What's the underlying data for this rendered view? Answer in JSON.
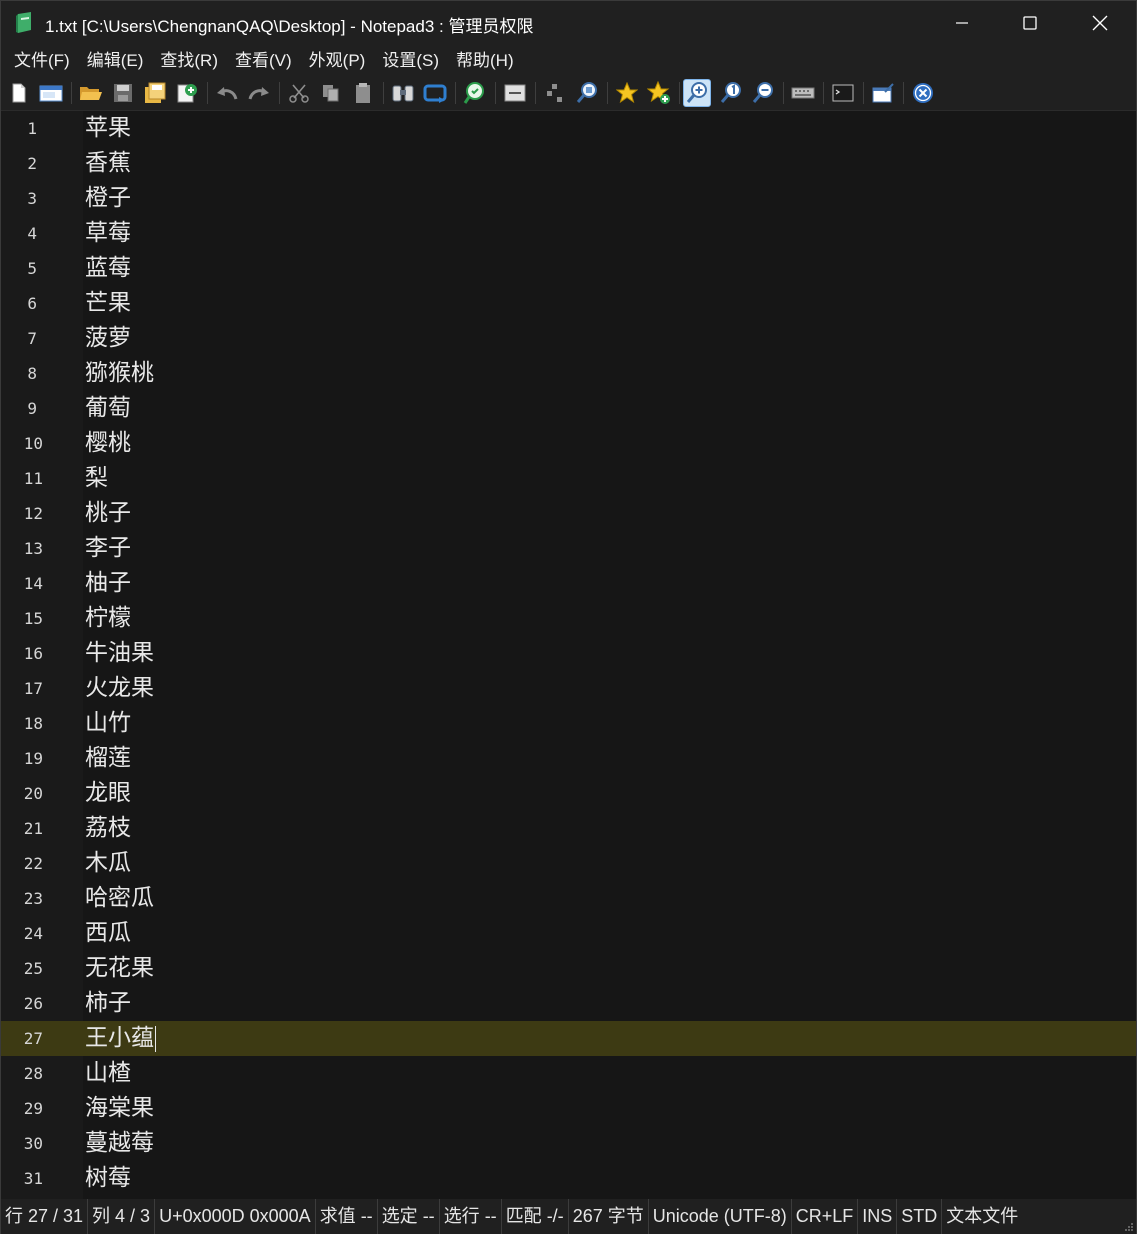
{
  "window": {
    "title": "1.txt [C:\\Users\\ChengnanQAQ\\Desktop] - Notepad3 : 管理员权限"
  },
  "menu": [
    {
      "label": "文件(F)"
    },
    {
      "label": "编辑(E)"
    },
    {
      "label": "查找(R)"
    },
    {
      "label": "查看(V)"
    },
    {
      "label": "外观(P)"
    },
    {
      "label": "设置(S)"
    },
    {
      "label": "帮助(H)"
    }
  ],
  "toolbar": [
    "new-file-icon",
    "new-window-icon",
    "open-folder-icon",
    "save-icon",
    "save-as-icon",
    "save-copy-icon",
    "undo-icon",
    "redo-icon",
    "cut-icon",
    "copy-icon",
    "paste-icon",
    "find-icon",
    "replace-icon",
    "find-in-files-icon",
    "goto-line-icon",
    "column-icon",
    "zoom-in-page-icon",
    "favorite-icon",
    "add-favorite-icon",
    "zoom-in-icon",
    "reset-zoom-icon",
    "zoom-out-icon",
    "scheme-icon",
    "terminal-icon",
    "pin-icon",
    "exit-icon"
  ],
  "editor": {
    "current_line": 27,
    "lines": [
      {
        "n": "1",
        "text": "苹果"
      },
      {
        "n": "2",
        "text": "香蕉"
      },
      {
        "n": "3",
        "text": "橙子"
      },
      {
        "n": "4",
        "text": "草莓"
      },
      {
        "n": "5",
        "text": "蓝莓"
      },
      {
        "n": "6",
        "text": "芒果"
      },
      {
        "n": "7",
        "text": "菠萝"
      },
      {
        "n": "8",
        "text": "猕猴桃"
      },
      {
        "n": "9",
        "text": "葡萄"
      },
      {
        "n": "10",
        "text": "樱桃"
      },
      {
        "n": "11",
        "text": "梨"
      },
      {
        "n": "12",
        "text": "桃子"
      },
      {
        "n": "13",
        "text": "李子"
      },
      {
        "n": "14",
        "text": "柚子"
      },
      {
        "n": "15",
        "text": "柠檬"
      },
      {
        "n": "16",
        "text": "牛油果"
      },
      {
        "n": "17",
        "text": "火龙果"
      },
      {
        "n": "18",
        "text": "山竹"
      },
      {
        "n": "19",
        "text": "榴莲"
      },
      {
        "n": "20",
        "text": "龙眼"
      },
      {
        "n": "21",
        "text": "荔枝"
      },
      {
        "n": "22",
        "text": "木瓜"
      },
      {
        "n": "23",
        "text": "哈密瓜"
      },
      {
        "n": "24",
        "text": "西瓜"
      },
      {
        "n": "25",
        "text": "无花果"
      },
      {
        "n": "26",
        "text": "柿子"
      },
      {
        "n": "27",
        "text": "王小蕴"
      },
      {
        "n": "28",
        "text": "山楂"
      },
      {
        "n": "29",
        "text": "海棠果"
      },
      {
        "n": "30",
        "text": "蔓越莓"
      },
      {
        "n": "31",
        "text": "树莓"
      }
    ]
  },
  "status": {
    "line": "行  27 / 31",
    "column": "列  4 / 3",
    "unicode": "U+0x000D 0x000A",
    "eval": "求值  --",
    "selection": "选定  --",
    "selected_lines": "选行  --",
    "match": "匹配  -/-",
    "bytes": "267 字节",
    "encoding": "Unicode (UTF-8)",
    "eol": "CR+LF",
    "ins": "INS",
    "std": "STD",
    "filetype": "文本文件"
  },
  "colors": {
    "background": "#161616",
    "current_line": "#3d3a13",
    "chrome": "#202020",
    "text": "#e8e8e8"
  }
}
